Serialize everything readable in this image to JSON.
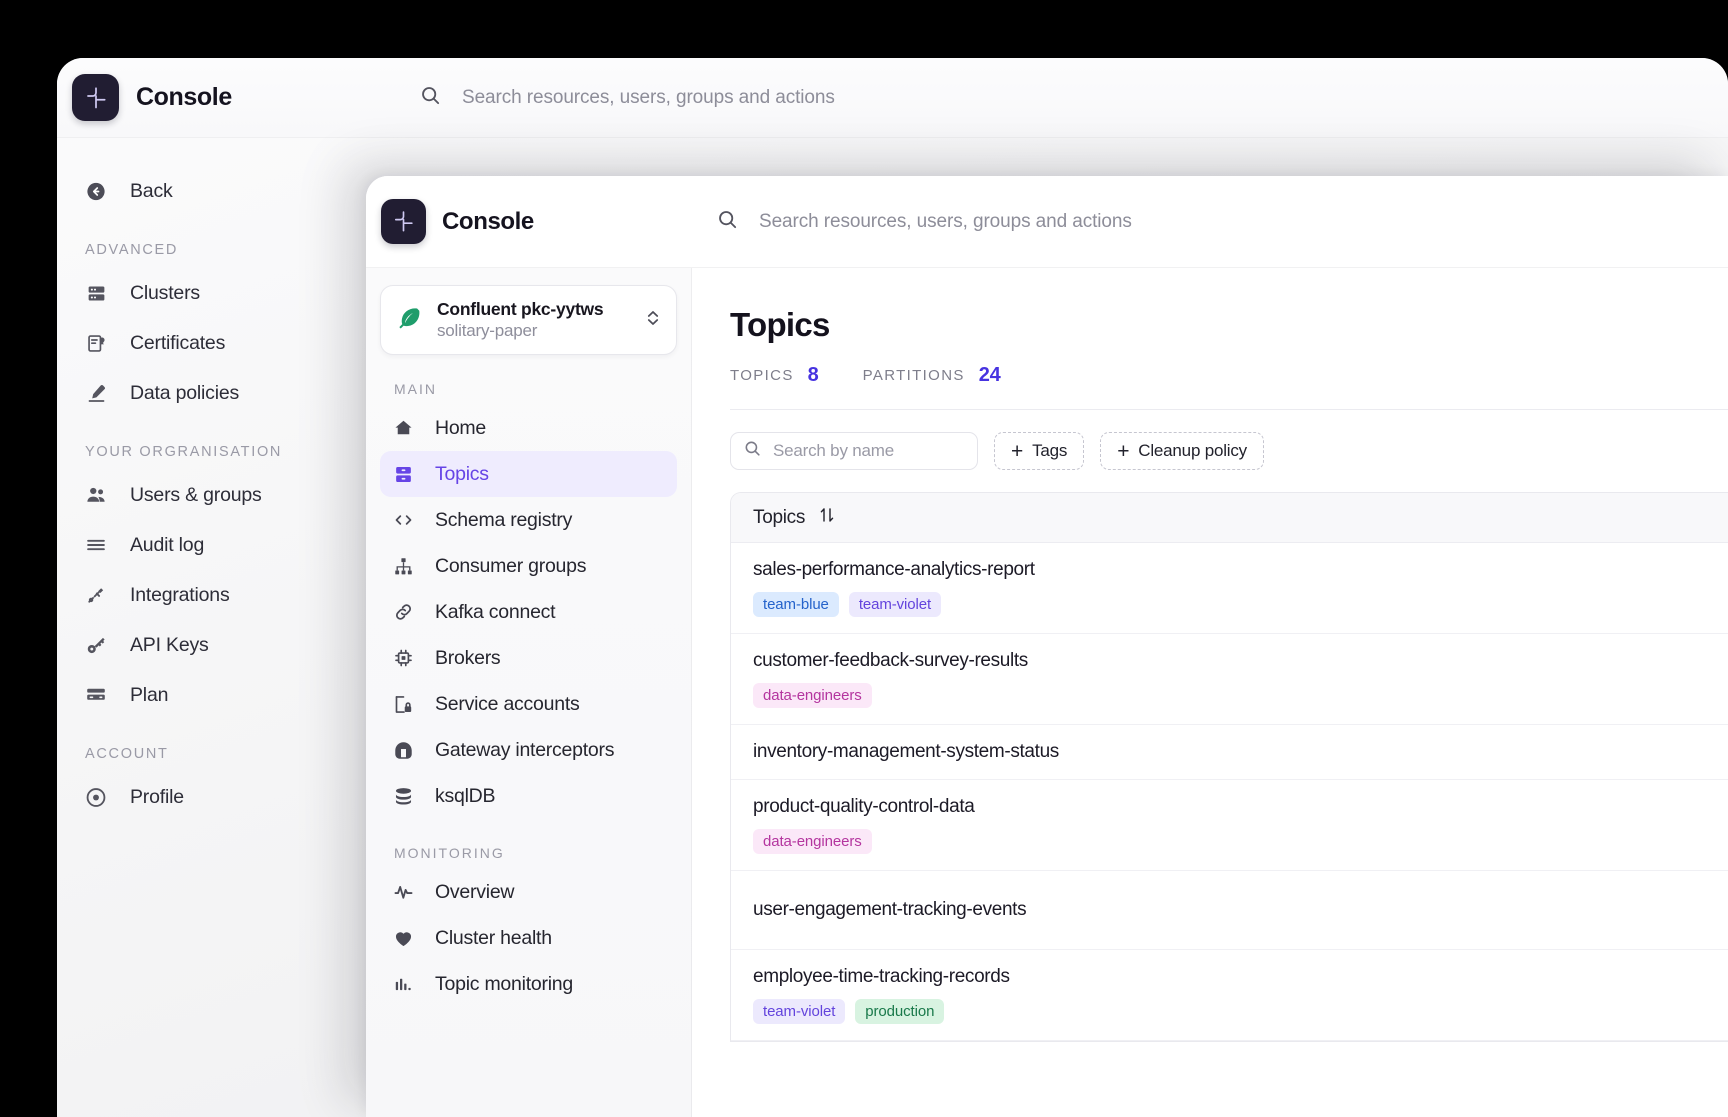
{
  "base_window": {
    "brand": {
      "name": "Console",
      "logo_icon": "console-logo-icon"
    },
    "search": {
      "placeholder": "Search resources, users, groups and actions",
      "icon": "search-icon"
    },
    "sidebar": {
      "back_label": "Back",
      "sections": [
        {
          "label": "ADVANCED",
          "items": [
            {
              "label": "Clusters",
              "icon": "server-icon"
            },
            {
              "label": "Certificates",
              "icon": "certificate-icon"
            },
            {
              "label": "Data policies",
              "icon": "pen-icon"
            }
          ]
        },
        {
          "label": "YOUR ORGRANISATION",
          "items": [
            {
              "label": "Users & groups",
              "icon": "users-icon"
            },
            {
              "label": "Audit log",
              "icon": "list-icon"
            },
            {
              "label": "Integrations",
              "icon": "plug-icon"
            },
            {
              "label": "API Keys",
              "icon": "key-icon"
            },
            {
              "label": "Plan",
              "icon": "card-icon"
            }
          ]
        },
        {
          "label": "ACCOUNT",
          "items": [
            {
              "label": "Profile",
              "icon": "user-circle-icon"
            }
          ]
        }
      ]
    }
  },
  "overlay": {
    "brand": {
      "name": "Console",
      "logo_icon": "console-logo-icon"
    },
    "search": {
      "placeholder": "Search resources, users, groups and actions",
      "icon": "search-icon"
    },
    "cluster_selector": {
      "name": "Confluent pkc-yytws",
      "subtitle": "solitary-paper",
      "icon": "feather-icon",
      "chevron_icon": "chevron-updown-icon",
      "icon_color": "#1f9d6b"
    },
    "sidebar": {
      "sections": [
        {
          "label": "MAIN",
          "items": [
            {
              "label": "Home",
              "icon": "home-icon",
              "active": false
            },
            {
              "label": "Topics",
              "icon": "topics-icon",
              "active": true
            },
            {
              "label": "Schema registry",
              "icon": "code-icon",
              "active": false
            },
            {
              "label": "Consumer groups",
              "icon": "hierarchy-icon",
              "active": false
            },
            {
              "label": "Kafka connect",
              "icon": "link-icon",
              "active": false
            },
            {
              "label": "Brokers",
              "icon": "chip-icon",
              "active": false
            },
            {
              "label": "Service accounts",
              "icon": "service-account-lock-icon",
              "active": false
            },
            {
              "label": "Gateway interceptors",
              "icon": "gateway-icon",
              "active": false
            },
            {
              "label": "ksqlDB",
              "icon": "database-icon",
              "active": false
            }
          ]
        },
        {
          "label": "MONITORING",
          "items": [
            {
              "label": "Overview",
              "icon": "pulse-icon",
              "active": false
            },
            {
              "label": "Cluster health",
              "icon": "heart-icon",
              "active": false
            },
            {
              "label": "Topic monitoring",
              "icon": "bar-chart-icon",
              "active": false
            }
          ]
        }
      ]
    },
    "main": {
      "title": "Topics",
      "stats": [
        {
          "label": "TOPICS",
          "value": "8"
        },
        {
          "label": "PARTITIONS",
          "value": "24"
        }
      ],
      "accent_color": "#4733e0",
      "filters": {
        "search_placeholder": "Search by name",
        "search_icon": "search-icon",
        "chips": [
          {
            "label": "Tags",
            "icon": "plus-icon"
          },
          {
            "label": "Cleanup policy",
            "icon": "plus-icon"
          }
        ]
      },
      "table": {
        "header": {
          "label": "Topics",
          "sort_icon": "sort-arrows-icon"
        },
        "rows": [
          {
            "name": "sales-performance-analytics-report",
            "tags": [
              {
                "label": "team-blue",
                "kind": "blue"
              },
              {
                "label": "team-violet",
                "kind": "violet"
              }
            ]
          },
          {
            "name": "customer-feedback-survey-results",
            "tags": [
              {
                "label": "data-engineers",
                "kind": "pink"
              }
            ]
          },
          {
            "name": "inventory-management-system-status",
            "tags": []
          },
          {
            "name": "product-quality-control-data",
            "tags": [
              {
                "label": "data-engineers",
                "kind": "pink"
              }
            ]
          },
          {
            "name": "user-engagement-tracking-events",
            "tags": []
          },
          {
            "name": "employee-time-tracking-records",
            "tags": [
              {
                "label": "team-violet",
                "kind": "violet"
              },
              {
                "label": "production",
                "kind": "green"
              }
            ]
          }
        ],
        "tag_colors": {
          "blue": {
            "bg": "#dbeafe",
            "fg": "#2563cb"
          },
          "violet": {
            "bg": "#ece9fd",
            "fg": "#6344dd"
          },
          "pink": {
            "bg": "#fbe8f8",
            "fg": "#b party"
          },
          "green": {
            "bg": "#d8f3e1",
            "fg": "#19794a"
          }
        }
      }
    }
  }
}
